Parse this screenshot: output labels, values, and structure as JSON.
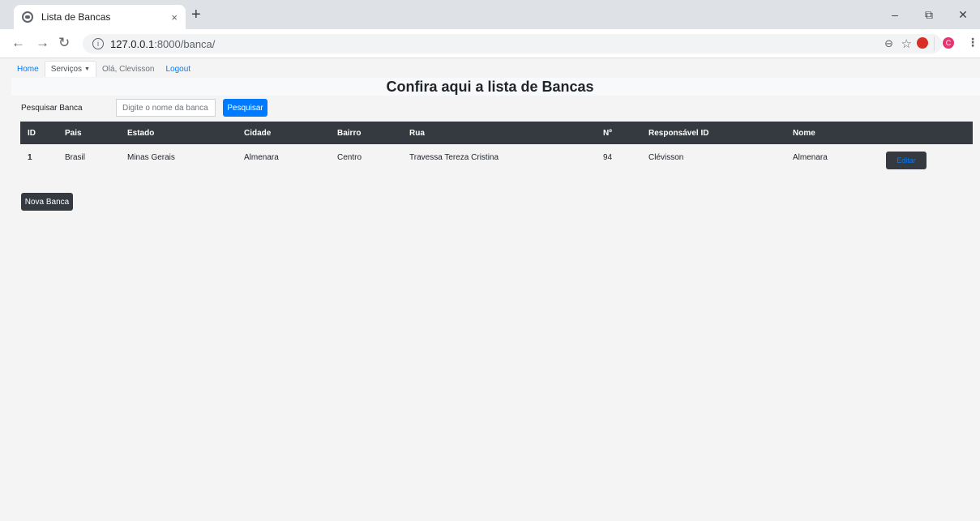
{
  "browser": {
    "tab_title": "Lista de Bancas",
    "tab_close": "×",
    "new_tab": "+",
    "url_host": "127.0.0.1",
    "url_path": ":8000/banca/",
    "profile_initial": "C",
    "window": {
      "minimize": "–",
      "restore": "⧉",
      "close": "✕"
    }
  },
  "nav": {
    "home": "Home",
    "servicos": "Serviços",
    "greeting": "Olá, Clevisson",
    "logout": "Logout"
  },
  "page": {
    "title": "Confira aqui a lista de Bancas"
  },
  "search": {
    "label": "Pesquisar Banca",
    "placeholder": "Digite o nome da banca",
    "button": "Pesquisar"
  },
  "table": {
    "headers": [
      "ID",
      "Pais",
      "Estado",
      "Cidade",
      "Bairro",
      "Rua",
      "Nº",
      "Responsável ID",
      "Nome",
      ""
    ],
    "rows": [
      {
        "id": "1",
        "pais": "Brasil",
        "estado": "Minas Gerais",
        "cidade": "Almenara",
        "bairro": "Centro",
        "rua": "Travessa Tereza Cristina",
        "numero": "94",
        "responsavel": "Clévisson",
        "nome": "Almenara",
        "action": "Editar"
      }
    ]
  },
  "actions": {
    "new_banca": "Nova Banca"
  },
  "colors": {
    "primary": "#007bff",
    "dark": "#343a40",
    "page_bg": "#f4f4f5"
  }
}
